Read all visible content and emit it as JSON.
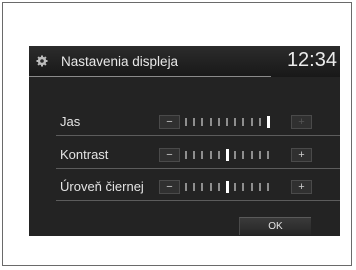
{
  "header": {
    "icon": "gear-icon",
    "title": "Nastavenia displeja",
    "clock": "12:34"
  },
  "settings": [
    {
      "label": "Jas",
      "minus": "−",
      "plus": "+",
      "level": 1.0,
      "steps": 11,
      "plus_enabled": false
    },
    {
      "label": "Kontrast",
      "minus": "−",
      "plus": "+",
      "level": 0.5,
      "steps": 11,
      "plus_enabled": true
    },
    {
      "label": "Úroveň čiernej",
      "minus": "−",
      "plus": "+",
      "level": 0.5,
      "steps": 11,
      "plus_enabled": true
    }
  ],
  "footer": {
    "ok_label": "OK"
  },
  "colors": {
    "screen_bg": "#232323",
    "text": "#e4e4e4",
    "divider": "#5c5c5c"
  }
}
